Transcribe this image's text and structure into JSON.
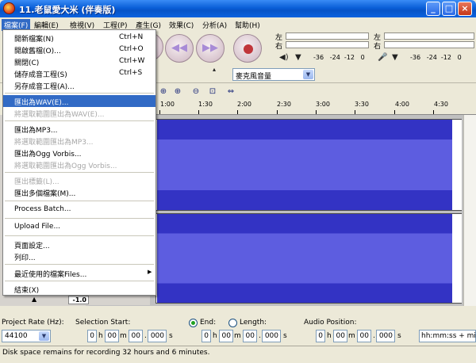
{
  "window": {
    "title": "11.老鼠愛大米 (伴奏版)",
    "minimize_label": "_",
    "maximize_label": "□",
    "close_label": "×"
  },
  "menubar": {
    "items": [
      "檔案(F)",
      "編輯(E)",
      "檢視(V)",
      "工程(P)",
      "產生(G)",
      "效果(C)",
      "分析(A)",
      "幫助(H)"
    ]
  },
  "file_menu": {
    "items": [
      {
        "label": "開新檔案(N)",
        "shortcut": "Ctrl+N",
        "state": "normal"
      },
      {
        "label": "開啟舊檔(O)...",
        "shortcut": "Ctrl+O",
        "state": "normal"
      },
      {
        "label": "關閉(C)",
        "shortcut": "Ctrl+W",
        "state": "normal"
      },
      {
        "label": "儲存成音工程(S)",
        "shortcut": "Ctrl+S",
        "state": "normal"
      },
      {
        "label": "另存成音工程(A)...",
        "shortcut": "",
        "state": "normal"
      },
      {
        "label": "匯出為WAV(E)...",
        "shortcut": "",
        "state": "highlighted"
      },
      {
        "label": "將選取範圍匯出為WAV(E)...",
        "shortcut": "",
        "state": "disabled"
      },
      {
        "label": "匯出為MP3...",
        "shortcut": "",
        "state": "normal"
      },
      {
        "label": "將選取範圍匯出為MP3...",
        "shortcut": "",
        "state": "disabled"
      },
      {
        "label": "匯出為Ogg Vorbis...",
        "shortcut": "",
        "state": "normal"
      },
      {
        "label": "將選取範圍匯出為Ogg Vorbis...",
        "shortcut": "",
        "state": "disabled"
      },
      {
        "label": "匯出標籤(L)...",
        "shortcut": "",
        "state": "disabled"
      },
      {
        "label": "匯出多個檔案(M)...",
        "shortcut": "",
        "state": "normal"
      },
      {
        "label": "Process Batch...",
        "shortcut": "",
        "state": "normal"
      },
      {
        "label": "Upload File...",
        "shortcut": "",
        "state": "normal"
      },
      {
        "label": "頁面設定...",
        "shortcut": "",
        "state": "normal"
      },
      {
        "label": "列印...",
        "shortcut": "",
        "state": "normal"
      },
      {
        "label": "最近使用的檔案Files...",
        "shortcut": "",
        "state": "normal",
        "submenu": true
      },
      {
        "label": "結束(X)",
        "shortcut": "",
        "state": "normal"
      }
    ]
  },
  "meters": {
    "left_label": "左",
    "right_label": "右",
    "scale": [
      "-36",
      "-24",
      "-12",
      "0"
    ]
  },
  "mixer": {
    "input_source": "麥克風音量"
  },
  "timeline": {
    "labels": [
      "1:00",
      "1:30",
      "2:00",
      "2:30",
      "3:00",
      "3:30",
      "4:00",
      "4:30"
    ]
  },
  "track": {
    "gain_value": "-1.0"
  },
  "bottom": {
    "project_rate_label": "Project Rate (Hz):",
    "project_rate_value": "44100",
    "selection_start_label": "Selection Start:",
    "end_label": "End:",
    "length_label": "Length:",
    "audio_position_label": "Audio Position:",
    "time_h": "0",
    "time_m": "00",
    "time_s": "00",
    "time_ms": "000",
    "h": "h",
    "m": "m",
    "s": "s",
    "dot": ".",
    "format": "hh:mm:ss + mi"
  },
  "status": {
    "text": "Disk space remains for recording 32 hours and 6 minutes."
  },
  "colors": {
    "waveform": "#3333c4",
    "waveform_rms": "#5d5de0",
    "highlight": "#316ac5",
    "titlebar": "#0a5fd8"
  }
}
